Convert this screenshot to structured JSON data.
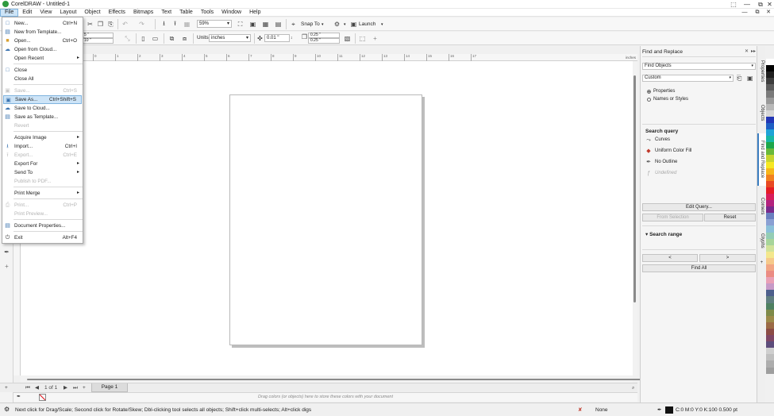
{
  "window": {
    "title": "CorelDRAW - Untitled-1",
    "controls": [
      "Help",
      "Minimize",
      "Restore",
      "Close"
    ]
  },
  "menubar": {
    "items": [
      "File",
      "Edit",
      "View",
      "Layout",
      "Object",
      "Effects",
      "Bitmaps",
      "Text",
      "Table",
      "Tools",
      "Window",
      "Help"
    ]
  },
  "toolbar": {
    "zoom": "59%",
    "snap_to": "Snap To",
    "launch": "Launch",
    "units_label": "Units:",
    "units_value": "inches",
    "nudge": "0.01 \"",
    "duplicate_x": "0.25 \"",
    "duplicate_y": "0.25 \"",
    "page_width": "5 \"",
    "page_height": "10 \""
  },
  "file_menu": {
    "items": [
      {
        "label": "New...",
        "shortcut": "Ctrl+N",
        "enabled": true
      },
      {
        "label": "New from Template...",
        "shortcut": "",
        "enabled": true
      },
      {
        "label": "Open...",
        "shortcut": "Ctrl+O",
        "enabled": true
      },
      {
        "label": "Open from Cloud...",
        "shortcut": "",
        "enabled": true
      },
      {
        "label": "Open Recent",
        "shortcut": "",
        "enabled": true,
        "submenu": true
      },
      {
        "label": "Close",
        "shortcut": "",
        "enabled": true
      },
      {
        "label": "Close All",
        "shortcut": "",
        "enabled": true
      },
      {
        "label": "Save...",
        "shortcut": "Ctrl+S",
        "enabled": false
      },
      {
        "label": "Save As...",
        "shortcut": "Ctrl+Shift+S",
        "enabled": true,
        "highlighted": true
      },
      {
        "label": "Save to Cloud...",
        "shortcut": "",
        "enabled": true
      },
      {
        "label": "Save as Template...",
        "shortcut": "",
        "enabled": true
      },
      {
        "label": "Revert",
        "shortcut": "",
        "enabled": false
      },
      {
        "label": "Acquire Image",
        "shortcut": "",
        "enabled": true,
        "submenu": true
      },
      {
        "label": "Import...",
        "shortcut": "Ctrl+I",
        "enabled": true
      },
      {
        "label": "Export...",
        "shortcut": "Ctrl+E",
        "enabled": false
      },
      {
        "label": "Export For",
        "shortcut": "",
        "enabled": true,
        "submenu": true
      },
      {
        "label": "Send To",
        "shortcut": "",
        "enabled": true,
        "submenu": true
      },
      {
        "label": "Publish to PDF...",
        "shortcut": "",
        "enabled": false
      },
      {
        "label": "Print Merge",
        "shortcut": "",
        "enabled": true,
        "submenu": true
      },
      {
        "label": "Print...",
        "shortcut": "Ctrl+P",
        "enabled": false
      },
      {
        "label": "Print Preview...",
        "shortcut": "",
        "enabled": false
      },
      {
        "label": "Document Properties...",
        "shortcut": "",
        "enabled": true
      },
      {
        "label": "Exit",
        "shortcut": "Alt+F4",
        "enabled": true
      }
    ]
  },
  "ruler": {
    "unit": "inches",
    "ticks": [
      "-5",
      "-4",
      "-3",
      "-2",
      "-1",
      "0",
      "1",
      "2",
      "3",
      "4",
      "5",
      "6",
      "7",
      "8",
      "9",
      "10",
      "11",
      "12",
      "13",
      "14",
      "15",
      "16",
      "17"
    ]
  },
  "page_nav": {
    "page_of": "1 of 1",
    "page_tab": "Page 1"
  },
  "colorbar": {
    "hint": "Drag colors (or objects) here to store these colors with your document"
  },
  "statusbar": {
    "message": "Next click for Drag/Scale; Second click for Rotate/Skew; Dbl-clicking tool selects all objects; Shift+click multi-selects; Alt+click digs",
    "fill": "None",
    "outline": "C:0 M:0 Y:0 K:100  0.500 pt"
  },
  "docker": {
    "title": "Find and Replace",
    "mode": "Find Objects",
    "preset": "Custom",
    "radio_properties": "Properties",
    "radio_names": "Names or Styles",
    "search_query_header": "Search query",
    "queries": [
      {
        "icon": "curves-icon",
        "label": "Curves",
        "enabled": true
      },
      {
        "icon": "fill-icon",
        "label": "Uniform Color Fill",
        "enabled": true
      },
      {
        "icon": "pen-icon",
        "label": "No Outline",
        "enabled": true
      },
      {
        "icon": "fx-icon",
        "label": "Undefined",
        "enabled": false
      }
    ],
    "edit_query": "Edit Query...",
    "from_selection": "From Selection",
    "reset": "Reset",
    "search_range": "Search range",
    "prev": "<",
    "next": ">",
    "find_all": "Find All"
  },
  "side_tabs": [
    "Properties",
    "Objects",
    "Find and Replace",
    "Corners",
    "Glyphs"
  ],
  "palette_colors": [
    "#ffffff",
    "#000000",
    "#1f1f1f",
    "#3d3d3d",
    "#5c5c5c",
    "#7a7a7a",
    "#999999",
    "#b8b8b8",
    "#d6d6d6",
    "#2336b5",
    "#1f5fc4",
    "#1fa3d7",
    "#18b7a4",
    "#1ea64a",
    "#69b93b",
    "#c6d42f",
    "#f6e723",
    "#f7b61a",
    "#f2811f",
    "#e84a23",
    "#e51d25",
    "#d81e5b",
    "#b3237e",
    "#7a2a8c",
    "#6a7fbf",
    "#8aa0d3",
    "#8bc0d9",
    "#94cdb5",
    "#a7d59b",
    "#d0e29a",
    "#f3e78d",
    "#f6c98a",
    "#f2a784",
    "#eb8c83",
    "#e9a0b6",
    "#c79ac7",
    "#4d5f8c",
    "#5f7e7f",
    "#4e8060",
    "#7e8a49",
    "#9c8a4a",
    "#9b6a46",
    "#8c4c45",
    "#7e4765",
    "#5d4d7b",
    "#cfcfcf",
    "#bfbfbf",
    "#adadad",
    "#9e9e9e"
  ]
}
